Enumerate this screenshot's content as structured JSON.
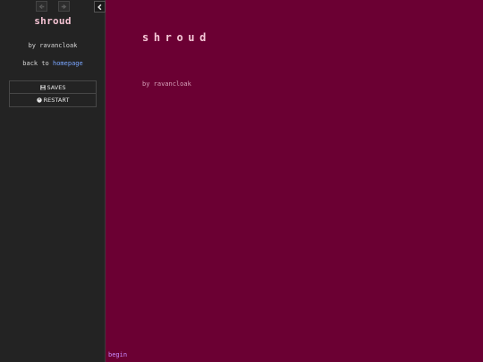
{
  "sidebar": {
    "title": "shroud",
    "author": "by ravancloak",
    "back_prefix": "back to",
    "back_link": "homepage",
    "buttons": {
      "saves": "SAVES",
      "restart": "RESTART"
    },
    "icons": {
      "back": "arrow-left-icon",
      "forward": "arrow-right-icon",
      "toggle": "chevron-left-icon",
      "saves": "save-icon",
      "restart": "power-icon"
    }
  },
  "passage": {
    "title": "shroud",
    "byline": "by ravancloak",
    "link": "begin"
  },
  "colors": {
    "background": "#6b0033",
    "sidebar": "#232323",
    "title": "#f4c3d3",
    "link": "#7aa6ff",
    "passage_link": "#c98aff"
  }
}
